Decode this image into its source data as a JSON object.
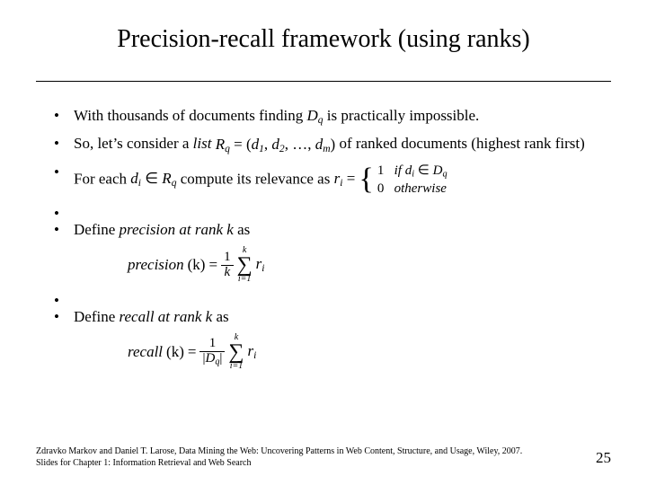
{
  "title": "Precision-recall framework (using ranks)",
  "bullets": {
    "b1_a": "With thousands of documents finding ",
    "b1_sym": "D",
    "b1_sub": "q",
    "b1_b": " is practically impossible.",
    "b2_a": "So, let’s consider a ",
    "b2_i": "list ",
    "b2_Rq_R": "R",
    "b2_Rq_q": "q",
    "b2_eq": " = (",
    "b2_d": "d",
    "b2_1": "1",
    "b2_comma": ", ",
    "b2_2": "2",
    "b2_dots": ", …, ",
    "b2_m": "m",
    "b2_close": ")",
    "b2_b": " of ranked documents (highest rank first)",
    "b3_a": "For each ",
    "b3_di_d": "d",
    "b3_di_i": "i",
    "b3_in": " ∈ ",
    "b3_Rq_R": "R",
    "b3_Rq_q": "q",
    "b3_b": " compute its relevance as ",
    "b3_ri_r": "r",
    "b3_ri_i": "i",
    "b3_eq": " = ",
    "cases_1": "1",
    "cases_if": "if ",
    "cases_Dq_D": "D",
    "cases_Dq_q": "q",
    "cases_0": "0",
    "cases_otherwise": "otherwise",
    "b4_a": "Define ",
    "b4_i": "precision at rank k",
    "b4_b": " as",
    "prec_word": "precision",
    "k_open": " (k) ",
    "eq": "=",
    "one": "1",
    "k_var": "k",
    "sum_top": "k",
    "sum_bot": "i=1",
    "ri_r": "r",
    "ri_i": "i",
    "b5_a": "Define ",
    "b5_i": "recall at rank k",
    "b5_b": " as",
    "rec_word": "recall",
    "abs_open": "|",
    "Dq_D": "D",
    "Dq_q": "q",
    "abs_close": "|"
  },
  "footer": {
    "line1": "Zdravko Markov and Daniel T. Larose, Data Mining the Web: Uncovering Patterns in Web Content, Structure, and Usage, Wiley, 2007.",
    "line2": "Slides for Chapter 1: Information Retrieval and Web Search"
  },
  "page": "25"
}
